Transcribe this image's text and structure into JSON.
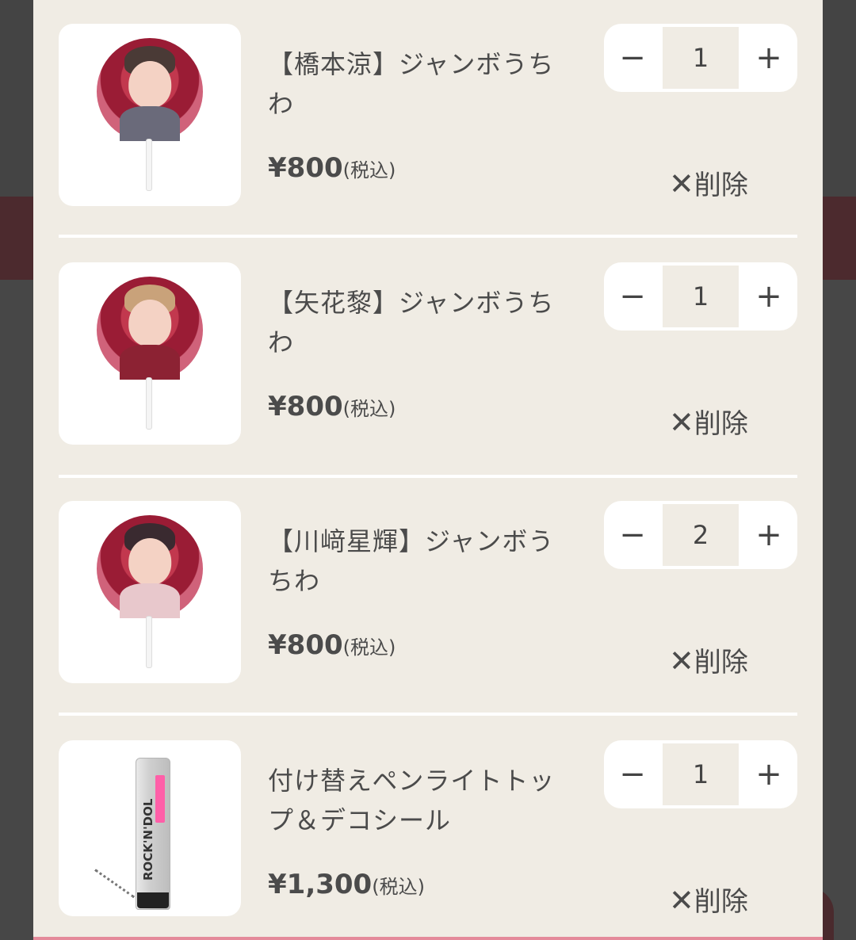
{
  "cart": {
    "items": [
      {
        "name": "【橋本涼】ジャンボうちわ",
        "price": "¥800",
        "tax_label": "(税込)",
        "quantity": "1",
        "delete_label": "削除",
        "thumb": "uchiwa-fan",
        "accent": "#c2384e"
      },
      {
        "name": "【矢花黎】ジャンボうちわ",
        "price": "¥800",
        "tax_label": "(税込)",
        "quantity": "1",
        "delete_label": "削除",
        "thumb": "uchiwa-fan",
        "accent": "#c2384e"
      },
      {
        "name": "【川﨑星輝】ジャンボうちわ",
        "price": "¥800",
        "tax_label": "(税込)",
        "quantity": "2",
        "delete_label": "削除",
        "thumb": "uchiwa-fan",
        "accent": "#c2384e"
      },
      {
        "name": "付け替えペンライトトップ＆デコシール",
        "price": "¥1,300",
        "tax_label": "(税込)",
        "quantity": "1",
        "delete_label": "削除",
        "thumb": "penlight-top",
        "thumb_text": "ROCK'N'DOL"
      }
    ],
    "minus_symbol": "−",
    "plus_symbol": "+",
    "delete_icon": "✕"
  },
  "colors": {
    "modal_bg": "#f0ece4",
    "text": "#4b4b4b",
    "accent_pink": "#e48a9a"
  }
}
